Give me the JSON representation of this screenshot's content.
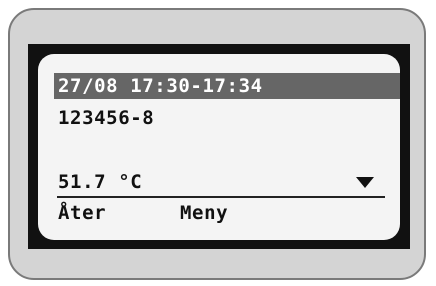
{
  "display": {
    "header": "27/08 17:30-17:34",
    "id_line": "123456-8",
    "temperature": "51.7 °C",
    "scroll_indicator": "triangle-down-icon"
  },
  "softkeys": {
    "left": "Åter",
    "right": "Meny"
  },
  "colors": {
    "bezel": "#d4d4d4",
    "frame": "#111111",
    "lcd_background": "#f4f4f4",
    "header_highlight": "#666666",
    "text": "#111111"
  }
}
